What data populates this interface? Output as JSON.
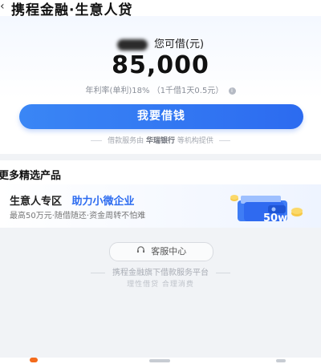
{
  "header": {
    "title": "携程金融·生意人贷"
  },
  "card": {
    "loan_label": "您可借(元)",
    "amount": "85,000",
    "rate_text": "年利率(单利)18% （1千借1天0.5元）",
    "borrow_button": "我要借钱",
    "provider_prefix": "借款服务由",
    "provider_bank": "华瑞银行",
    "provider_suffix": "等机构提供"
  },
  "products": {
    "heading": "更多精选产品",
    "item": {
      "title": "生意人专区",
      "slogan": "助力小微企业",
      "subtitle": "最高50万元·随借随还·资金周转不怕难",
      "badge": "50w"
    }
  },
  "footer": {
    "service_button": "客服中心",
    "platform_text": "携程金融旗下借款服务平台",
    "slogan": "理性借贷 合理消费"
  },
  "colors": {
    "primary": "#2c6bf0",
    "tab_active": "#f36b1c"
  }
}
